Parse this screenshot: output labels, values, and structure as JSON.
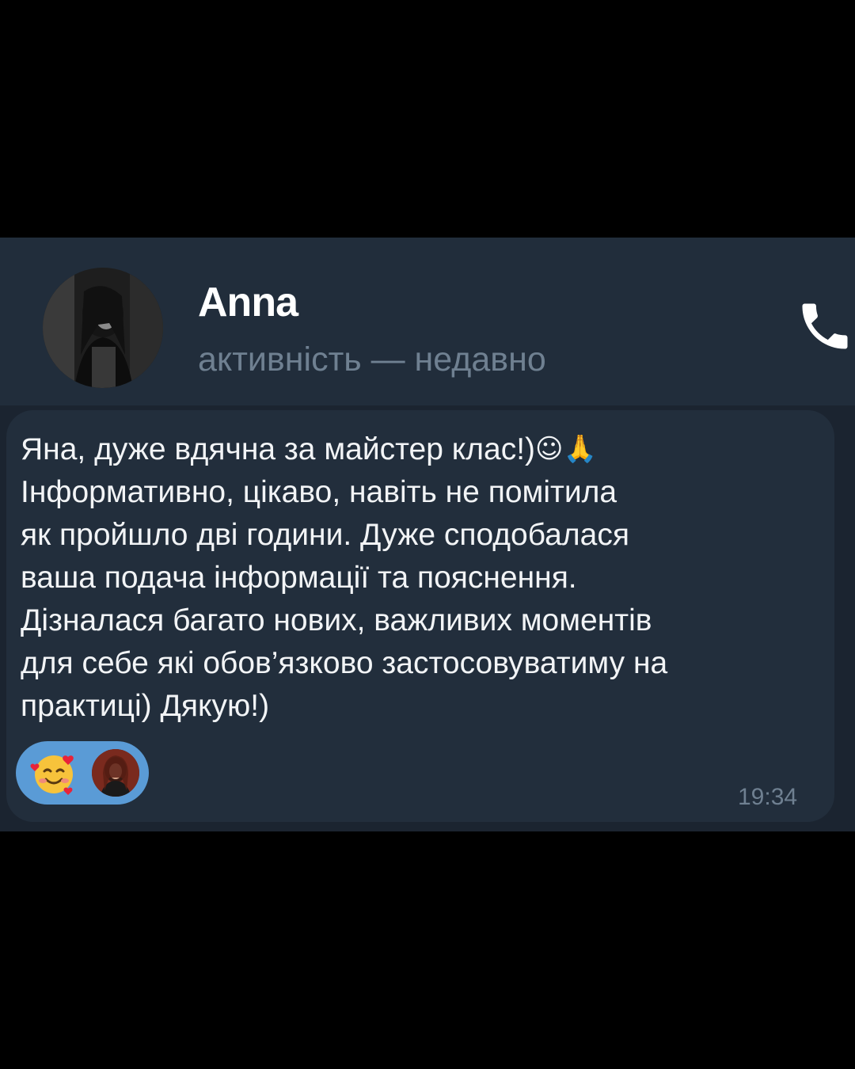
{
  "contact": {
    "name": "Anna",
    "status": "активність — недавно"
  },
  "message": {
    "lines": [
      "Яна, дуже вдячна за майстер клас!)",
      "Інформативно, цікаво, навіть не помітила",
      "як пройшло дві години. Дуже сподобалася",
      "ваша подача інформації та пояснення.",
      "Дізналася багато нових, важливих моментів",
      "для себе які обов’язково застосовуватиму на",
      "практиці) Дякую!)"
    ],
    "emojis": [
      "☺",
      "🙏"
    ],
    "time": "19:34"
  },
  "reaction": {
    "emoji": "smiling-face-with-hearts-icon",
    "count_avatar": "reactor-avatar"
  },
  "colors": {
    "header_bg": "#212d3b",
    "chat_bg": "#1b2430",
    "bubble_bg": "#222e3c",
    "muted_text": "#6f8091",
    "reaction_pill": "#5a9bd6"
  }
}
